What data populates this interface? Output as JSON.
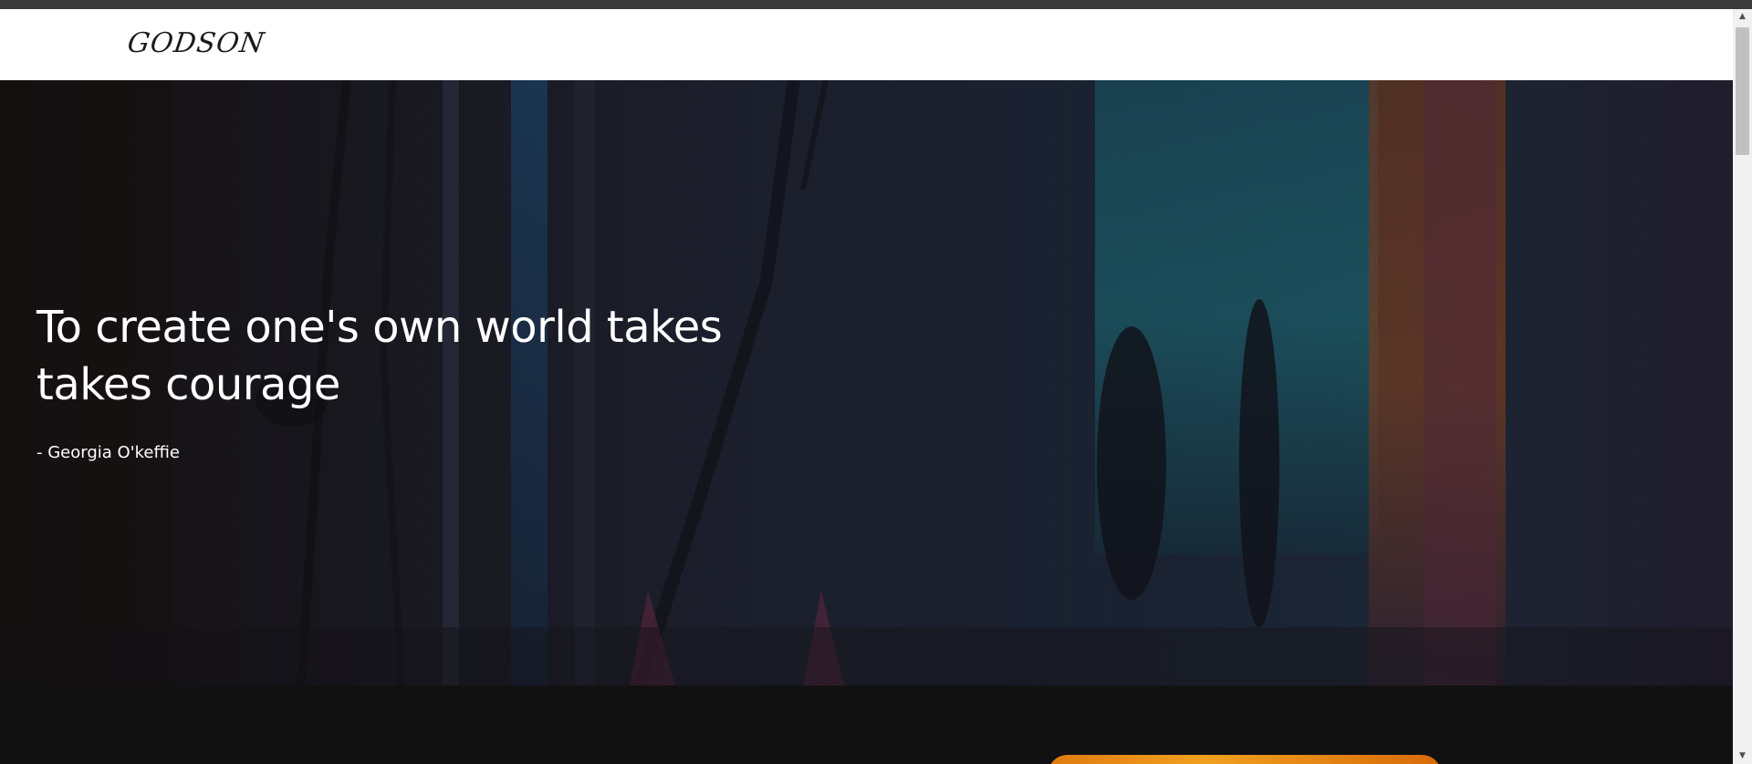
{
  "header": {
    "logo_text": "GODSON"
  },
  "hero": {
    "quote": "To create one's own world takes takes courage",
    "author": "- Georgia O'keffie"
  },
  "scrollbar": {
    "up_arrow": "▲",
    "down_arrow": "▼"
  },
  "colors": {
    "top_strip": "#3b3b3b",
    "navbar_background": "#ffffff",
    "hero_text": "#ffffff",
    "page_background": "#111111",
    "accent_orange": "#f0a020"
  },
  "icons": {
    "scroll_up": "scroll-up-arrow-icon",
    "scroll_down": "scroll-down-arrow-icon"
  }
}
